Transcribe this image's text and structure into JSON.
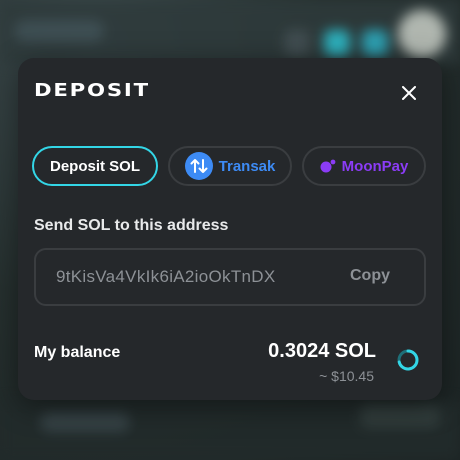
{
  "modal": {
    "title": "DEPOSIT",
    "close_icon": "close-icon"
  },
  "tabs": [
    {
      "label": "Deposit SOL",
      "selected": true,
      "icon": ""
    },
    {
      "label": "Transak",
      "selected": false,
      "icon": "transak-logo-icon"
    },
    {
      "label": "MoonPay",
      "selected": false,
      "icon": "moonpay-logo-icon"
    }
  ],
  "address_section": {
    "label": "Send SOL to this address",
    "address": "9tKisVa4VkIk6iA2ioOkTnDX",
    "copy_label": "Copy"
  },
  "balance": {
    "label": "My balance",
    "amount": "0.3024 SOL",
    "usd": "~ $10.45",
    "refresh_icon": "loading-spinner-icon"
  },
  "colors": {
    "accent": "#33d6e6",
    "transak": "#3d8bf5",
    "moonpay": "#8b3cf6",
    "modal_bg": "#25282b"
  }
}
